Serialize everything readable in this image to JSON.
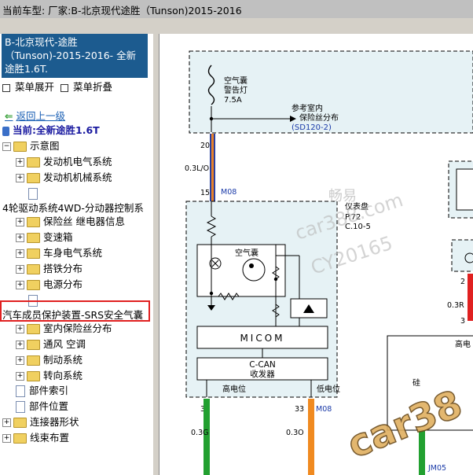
{
  "window": {
    "title": "当前车型:  厂家:B-北京现代途胜（Tunson)2015-2016"
  },
  "sidebar": {
    "header": "B-北京现代-途胜（Tunson)-2015-2016- 全新途胜1.6T.",
    "expand_all": "菜单展开",
    "collapse_all": "菜单折叠",
    "back": "返回上一级",
    "current": "当前:全新途胜1.6T",
    "tree": [
      {
        "label": "示意图"
      },
      {
        "label": "发动机电气系统"
      },
      {
        "label": "发动机机械系统"
      },
      {
        "label": ""
      },
      {
        "label": "4轮驱动系统4WD-分动器控制系"
      },
      {
        "label": "保险丝 继电器信息"
      },
      {
        "label": "变速箱"
      },
      {
        "label": "车身电气系统"
      },
      {
        "label": "搭铁分布"
      },
      {
        "label": "电源分布"
      },
      {
        "label": ""
      },
      {
        "label": "汽车成员保护装置-SRS安全气囊"
      },
      {
        "label": "室内保险丝分布"
      },
      {
        "label": "通风 空调"
      },
      {
        "label": "制动系统"
      },
      {
        "label": "转向系统"
      },
      {
        "label": "部件索引"
      },
      {
        "label": "部件位置"
      },
      {
        "label": "连接器形状"
      },
      {
        "label": "线束布置"
      }
    ]
  },
  "diagram": {
    "fuse_label_1": "空气囊",
    "fuse_label_2": "警告灯",
    "fuse_rating": "7.5A",
    "ref_1": "参考室内",
    "ref_2": "保险丝分布",
    "ref_code": "(SD120-2)",
    "pin_20": "20",
    "wire_1": "0.3L/O",
    "pin_15": "15",
    "conn_m08_a": "M08",
    "cluster_label": "仪表盘",
    "cluster_ref_1": "P.72",
    "cluster_ref_2": "C.10-5",
    "airbag_label": "空气囊",
    "micom": "MICOM",
    "ccan_1": "C-CAN",
    "ccan_2": "收发器",
    "high_label": "高电位",
    "low_label": "低电位",
    "pin_32": "32",
    "pin_33": "33",
    "conn_m08_b": "M08",
    "wire_g": "0.3G",
    "wire_o": "0.3O",
    "pin_2": "2",
    "wire_r": "0.3R",
    "pin_3": "3",
    "right_high": "高电",
    "right_low": "硅",
    "jm05": "JM05",
    "watermark_1": "畅易",
    "watermark_2": "car388.com",
    "watermark_3": "CY20165",
    "watermark_4": "car38"
  }
}
